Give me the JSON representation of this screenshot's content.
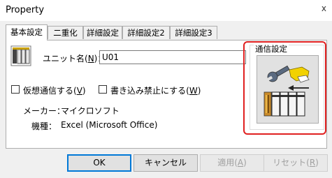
{
  "window": {
    "title": "Property",
    "close_label": "x"
  },
  "tabs": [
    "基本設定",
    "二重化",
    "詳細設定",
    "詳細設定2",
    "詳細設定3"
  ],
  "unit": {
    "label_prefix": "ユニット名(",
    "label_key": "N",
    "label_suffix": ")：",
    "value": "U01"
  },
  "options": {
    "virtual_comm": {
      "prefix": "仮想通信する(",
      "key": "V",
      "suffix": ")"
    },
    "write_protect": {
      "prefix": "書き込み禁止にする(",
      "key": "W",
      "suffix": ")"
    }
  },
  "info": {
    "maker_label": "メーカー：",
    "maker_value": "マイクロソフト",
    "model_label": "機種：",
    "model_value": "Excel (Microsoft Office)"
  },
  "comm": {
    "group_title": "通信設定"
  },
  "buttons": {
    "ok": "OK",
    "cancel": "キャンセル",
    "apply": {
      "prefix": "適用(",
      "key": "A",
      "suffix": ")"
    },
    "reset": {
      "prefix": "リセット(",
      "key": "R",
      "suffix": ")"
    }
  },
  "colors": {
    "highlight": "#e02020",
    "default_button_border": "#0078d7",
    "dialog_bg": "#f0f0f0"
  }
}
